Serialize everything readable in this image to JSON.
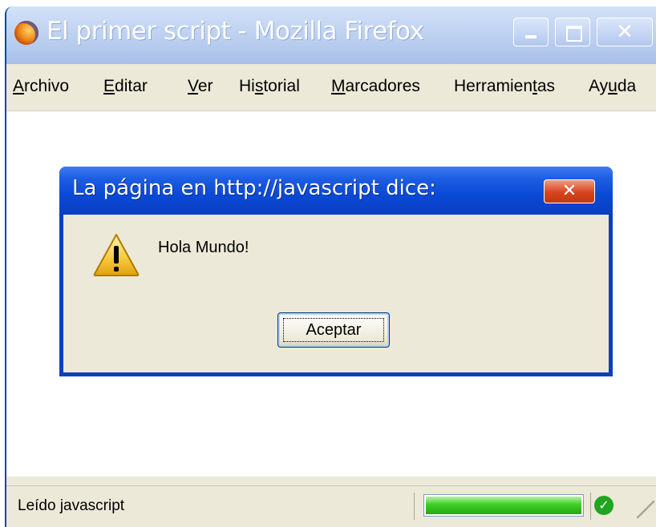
{
  "window": {
    "title": "El primer script - Mozilla Firefox",
    "buttons": {
      "minimize": "minimize",
      "maximize": "maximize",
      "close": "✕"
    }
  },
  "menu": [
    {
      "label": "Archivo"
    },
    {
      "label": "Editar"
    },
    {
      "label": "Ver"
    },
    {
      "label": "Historial"
    },
    {
      "label": "Marcadores"
    },
    {
      "label": "Herramientas"
    },
    {
      "label": "Ayuda"
    }
  ],
  "status": {
    "text": "Leído javascript",
    "progress": 1.0,
    "secure_icon": "check-icon"
  },
  "dialog": {
    "title": "La página en http://javascript dice:",
    "close": "✕",
    "icon": "warning-icon",
    "message": "Hola Mundo!",
    "button": "Aceptar"
  }
}
